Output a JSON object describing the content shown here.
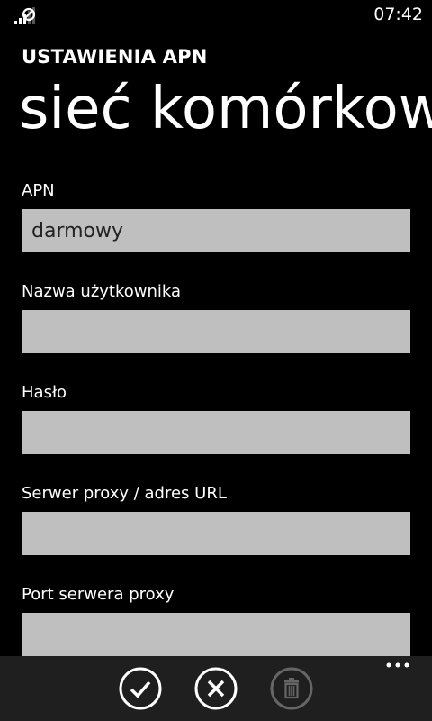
{
  "status_bar": {
    "time": "07:42",
    "signal_icon": "signal-strength-icon"
  },
  "header": {
    "app_title": "USTAWIENIA APN",
    "page_title": "sieć komórkow"
  },
  "form": {
    "fields": [
      {
        "label": "APN",
        "value": "darmowy",
        "placeholder": ""
      },
      {
        "label": "Nazwa użytkownika",
        "value": "",
        "placeholder": ""
      },
      {
        "label": "Hasło",
        "value": "",
        "placeholder": ""
      },
      {
        "label": "Serwer proxy / adres URL",
        "value": "",
        "placeholder": ""
      },
      {
        "label": "Port serwera proxy",
        "value": "",
        "placeholder": ""
      }
    ]
  },
  "app_bar": {
    "buttons": [
      {
        "icon": "check-icon",
        "enabled": true
      },
      {
        "icon": "cancel-icon",
        "enabled": true
      },
      {
        "icon": "delete-icon",
        "enabled": false
      }
    ],
    "more_icon": "ellipsis-icon",
    "background": "#1f1f1f"
  },
  "colors": {
    "background": "#000000",
    "text": "#ffffff",
    "input_background": "#bfbfbf",
    "disabled": "#666666"
  }
}
